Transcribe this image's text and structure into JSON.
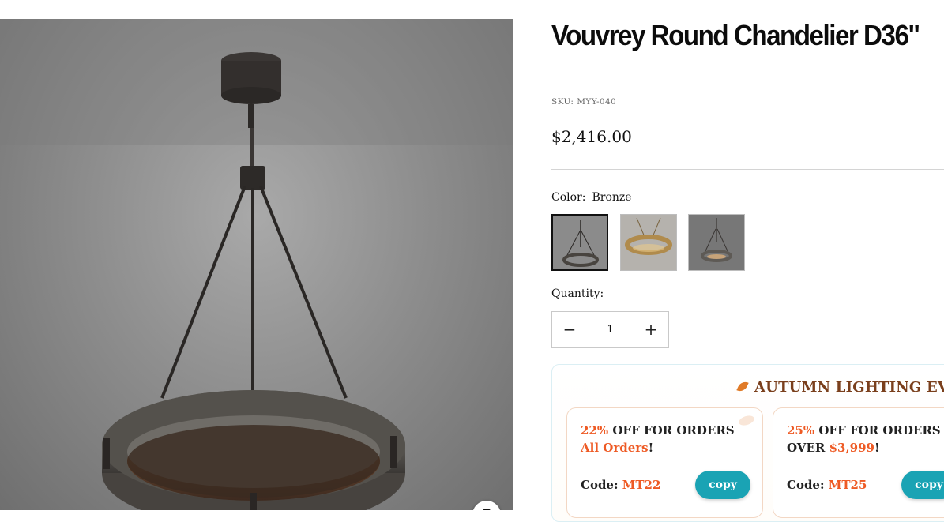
{
  "product": {
    "title": "Vouvrey Round Chandelier D36\"",
    "sku_label": "SKU:",
    "sku_value": "MYY-040",
    "price": "$2,416.00"
  },
  "options": {
    "color_label": "Color:",
    "color_selected": "Bronze",
    "swatches": [
      "Bronze",
      "Brass",
      "Grey"
    ]
  },
  "quantity": {
    "label": "Quantity:",
    "value": "1",
    "minus": "−",
    "plus": "+"
  },
  "promo": {
    "heading": "AUTUMN LIGHTING EVENT",
    "heading_icon": "leaf-icon",
    "coupons": [
      {
        "discount": "22%",
        "offer_text": " OFF FOR ORDERS",
        "condition": "All Orders",
        "suffix": "!",
        "code_label": "Code: ",
        "code": "MT22",
        "copy_label": "copy"
      },
      {
        "discount": "25%",
        "offer_text": " OFF FOR ORDERS",
        "condition_prefix": "OVER ",
        "condition": "$3,999",
        "suffix": "!",
        "code_label": "Code: ",
        "code": "MT25",
        "copy_label": "copy"
      }
    ]
  },
  "colors": {
    "accent_orange": "#ee5a24",
    "copy_button": "#1aa3b4",
    "promo_heading": "#7a3f1c"
  }
}
